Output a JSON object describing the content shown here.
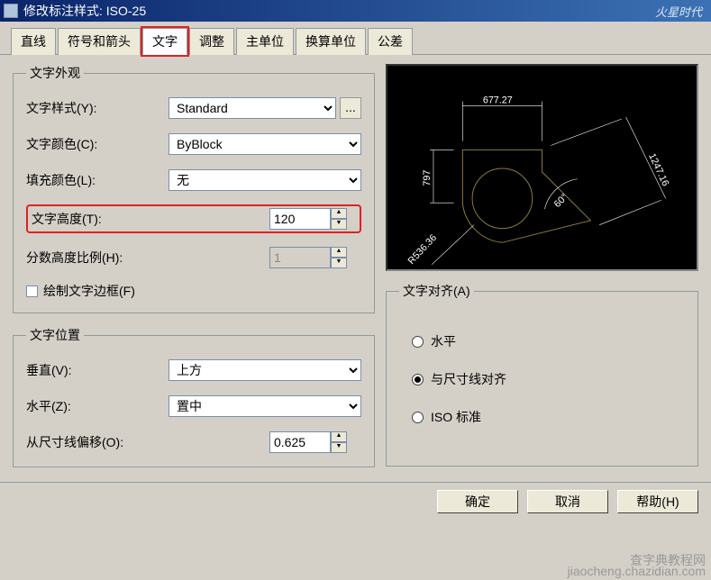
{
  "window": {
    "title": "修改标注样式: ISO-25",
    "brand": "火星时代"
  },
  "tabs": {
    "items": [
      {
        "label": "直线"
      },
      {
        "label": "符号和箭头"
      },
      {
        "label": "文字"
      },
      {
        "label": "调整"
      },
      {
        "label": "主单位"
      },
      {
        "label": "换算单位"
      },
      {
        "label": "公差"
      }
    ]
  },
  "appearance": {
    "legend": "文字外观",
    "style_label": "文字样式(Y):",
    "style_value": "Standard",
    "color_label": "文字颜色(C):",
    "color_value": "ByBlock",
    "fill_label": "填充颜色(L):",
    "fill_value": "无",
    "height_label": "文字高度(T):",
    "height_value": "120",
    "fraction_label": "分数高度比例(H):",
    "fraction_value": "1",
    "frame_label": "绘制文字边框(F)"
  },
  "placement": {
    "legend": "文字位置",
    "vert_label": "垂直(V):",
    "vert_value": "上方",
    "horz_label": "水平(Z):",
    "horz_value": "置中",
    "offset_label": "从尺寸线偏移(O):",
    "offset_value": "0.625"
  },
  "align": {
    "legend": "文字对齐(A)",
    "opt_horiz": "水平",
    "opt_dim": "与尺寸线对齐",
    "opt_iso": "ISO 标准"
  },
  "preview": {
    "d1": "677.27",
    "d2": "1247.16",
    "d3": "797",
    "d4": "R536.36",
    "d5": "60°"
  },
  "buttons": {
    "ok": "确定",
    "cancel": "取消",
    "help": "帮助(H)"
  },
  "footer": {
    "site": "查字典教程网",
    "url": "jiaocheng.chazidian.com"
  }
}
